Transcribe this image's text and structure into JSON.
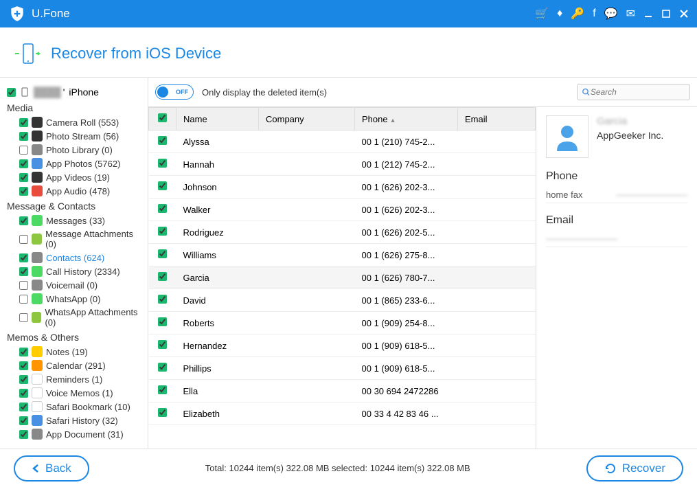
{
  "app": {
    "name": "U.Fone"
  },
  "titleIcons": [
    "cart",
    "diamond",
    "key",
    "facebook",
    "chat",
    "feedback",
    "minimize",
    "maximize",
    "close"
  ],
  "page": {
    "title": "Recover from iOS Device"
  },
  "device": {
    "name": "iPhone",
    "prefix": "' "
  },
  "sidebar": {
    "sections": [
      {
        "title": "Media",
        "items": [
          {
            "label": "Camera Roll (553)",
            "checked": true,
            "icon": "camera",
            "bg": "#333"
          },
          {
            "label": "Photo Stream (56)",
            "checked": true,
            "icon": "stream",
            "bg": "#333"
          },
          {
            "label": "Photo Library (0)",
            "checked": false,
            "icon": "library",
            "bg": "#888"
          },
          {
            "label": "App Photos (5762)",
            "checked": true,
            "icon": "appphoto",
            "bg": "#4a90e2"
          },
          {
            "label": "App Videos (19)",
            "checked": true,
            "icon": "video",
            "bg": "#333"
          },
          {
            "label": "App Audio (478)",
            "checked": true,
            "icon": "audio",
            "bg": "#e74c3c"
          }
        ]
      },
      {
        "title": "Message & Contacts",
        "items": [
          {
            "label": "Messages (33)",
            "checked": true,
            "icon": "msg",
            "bg": "#4cd964"
          },
          {
            "label": "Message Attachments (0)",
            "checked": false,
            "icon": "attach",
            "bg": "#8dc63f"
          },
          {
            "label": "Contacts (624)",
            "checked": true,
            "icon": "contact",
            "bg": "#888",
            "selected": true
          },
          {
            "label": "Call History (2334)",
            "checked": true,
            "icon": "call",
            "bg": "#4cd964"
          },
          {
            "label": "Voicemail (0)",
            "checked": false,
            "icon": "vm",
            "bg": "#888"
          },
          {
            "label": "WhatsApp (0)",
            "checked": false,
            "icon": "wa",
            "bg": "#4cd964"
          },
          {
            "label": "WhatsApp Attachments (0)",
            "checked": false,
            "icon": "waatt",
            "bg": "#8dc63f"
          }
        ]
      },
      {
        "title": "Memos & Others",
        "items": [
          {
            "label": "Notes (19)",
            "checked": true,
            "icon": "notes",
            "bg": "#ffcc00"
          },
          {
            "label": "Calendar (291)",
            "checked": true,
            "icon": "cal",
            "bg": "#ff9500"
          },
          {
            "label": "Reminders (1)",
            "checked": true,
            "icon": "rem",
            "bg": "#fff",
            "border": true
          },
          {
            "label": "Voice Memos (1)",
            "checked": true,
            "icon": "vmemo",
            "bg": "#fff",
            "border": true
          },
          {
            "label": "Safari Bookmark (10)",
            "checked": true,
            "icon": "bookmark",
            "bg": "#fff",
            "border": true
          },
          {
            "label": "Safari History (32)",
            "checked": true,
            "icon": "history",
            "bg": "#4a90e2"
          },
          {
            "label": "App Document (31)",
            "checked": true,
            "icon": "doc",
            "bg": "#888"
          }
        ]
      }
    ]
  },
  "toolbar": {
    "toggleLabel": "OFF",
    "toggleText": "Only display the deleted item(s)",
    "searchPlaceholder": "Search"
  },
  "table": {
    "headers": [
      "Name",
      "Company",
      "Phone",
      "Email"
    ],
    "rows": [
      {
        "name": "Alyssa",
        "company": "",
        "phone": "00 1 (210) 745-2...",
        "email": ""
      },
      {
        "name": "Hannah",
        "company": "",
        "phone": "00 1 (212) 745-2...",
        "email": ""
      },
      {
        "name": "Johnson",
        "company": "",
        "phone": "00 1 (626) 202-3...",
        "email": ""
      },
      {
        "name": "Walker",
        "company": "",
        "phone": "00 1 (626) 202-3...",
        "email": ""
      },
      {
        "name": "Rodriguez",
        "company": "",
        "phone": "00 1 (626) 202-5...",
        "email": ""
      },
      {
        "name": "Williams",
        "company": "",
        "phone": "00 1 (626) 275-8...",
        "email": ""
      },
      {
        "name": "Garcia",
        "company": "",
        "phone": "00 1 (626) 780-7...",
        "email": "",
        "selected": true
      },
      {
        "name": "David",
        "company": "",
        "phone": "00 1 (865) 233-6...",
        "email": ""
      },
      {
        "name": "Roberts",
        "company": "",
        "phone": "00 1 (909) 254-8...",
        "email": ""
      },
      {
        "name": "Hernandez",
        "company": "",
        "phone": "00 1 (909) 618-5...",
        "email": ""
      },
      {
        "name": "Phillips",
        "company": "",
        "phone": "00 1 (909) 618-5...",
        "email": ""
      },
      {
        "name": "Ella",
        "company": "",
        "phone": "00 30 694 2472286",
        "email": ""
      },
      {
        "name": "Elizabeth",
        "company": "",
        "phone": "00 33 4 42 83 46 ...",
        "email": ""
      }
    ]
  },
  "detail": {
    "name": "Garcia",
    "company": "AppGeeker Inc.",
    "phoneTitle": "Phone",
    "phoneLabel": "home fax",
    "phoneValue": "————————",
    "emailTitle": "Email",
    "emailValue": "————————"
  },
  "footer": {
    "back": "Back",
    "status": "Total: 10244 item(s) 322.08 MB    selected: 10244 item(s) 322.08 MB",
    "recover": "Recover"
  }
}
